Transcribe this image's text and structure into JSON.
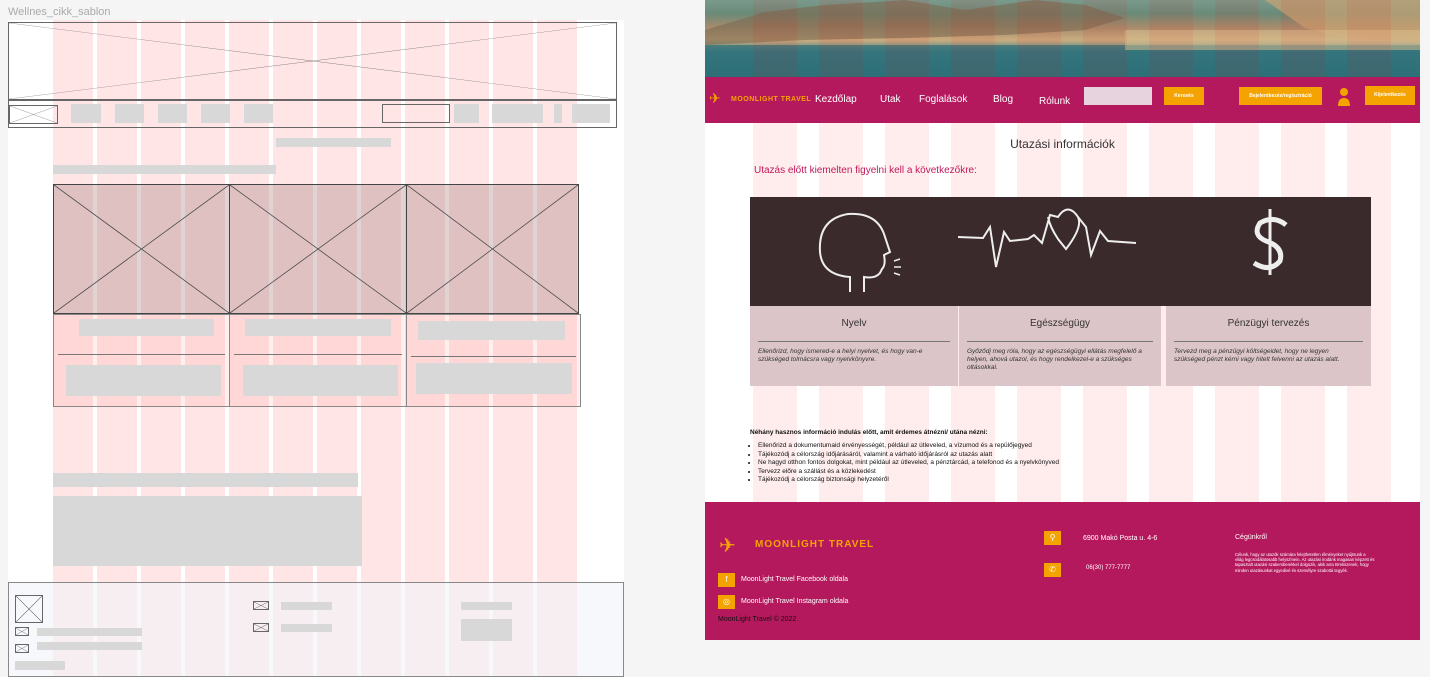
{
  "wireframe": {
    "frame_label": "Wellnes_cikk_sablon"
  },
  "site": {
    "brand": "MOONLIGHT TRAVEL",
    "nav": [
      "Kezdőlap",
      "Utak",
      "Foglalások",
      "Blog",
      "Rólunk"
    ],
    "search_placeholder": "",
    "search_button": "Keresés",
    "login_button": "Bejelentkezés/regisztráció",
    "logout_button": "Kijelentkezés",
    "colors": {
      "primary": "#b5195d",
      "accent": "#f5a300",
      "heading_accent": "#c2185b"
    }
  },
  "content": {
    "page_title": "Utazási információk",
    "subtitle": "Utazás előtt kiemelten figyelni kell a következőkre:",
    "cards": [
      {
        "icon": "head-speaking-icon",
        "title": "Nyelv",
        "text": "Ellenőrizd, hogy ismered-e a helyi nyelvet, és hogy van-e szükséged tolmácsra vagy nyelvkönyvre."
      },
      {
        "icon": "heartbeat-icon",
        "title": "Egészségügy",
        "text": "Győződj meg róla, hogy az egészségügyi ellátás megfelelő a helyen, ahová utazol, és hogy rendelkezel-e a szükséges oltásokkal."
      },
      {
        "icon": "dollar-icon",
        "title": "Pénzügyi tervezés",
        "text": "Tervezd meg a pénzügyi költségeidet, hogy ne legyen szükséged pénzt kérni vagy hitelt felvenni az utazás alatt."
      }
    ],
    "tips_title": "Néhány hasznos információ indulás előtt, amit érdemes átnézni/ utána nézni:",
    "tips": [
      "Ellenőrizd a dokumentumaid érvényességét, például az útleveled, a vízumod és a repülőjegyed",
      "Tájékozódj a célország időjárásáról, valamint a várható időjárásról az utazás alatt",
      "Ne hagyd otthon fontos dolgokat, mint például az útleveled, a pénztárcád, a telefonod és a nyelvkönyved",
      "Tervezz előre a szállást és a közlekedést",
      "Tájékozódj a célország biztonsági helyzetéről"
    ]
  },
  "footer": {
    "facebook": "MoonLight Travel Facebook oldala",
    "instagram": "MoonLight Travel Instagram oldala",
    "copyright": "MoonLight Travel © 2022",
    "address": "6900 Makó Posta u. 4-6",
    "phone": "06(30) 777-7777",
    "about_title": "Cégünkről",
    "about_text": "Célunk, hogy az utazók számára felejthetetlen élményeket nyújtsunk a világ legcsodálatosabb helyszínein. Az utazási irodánk magasan képzett és tapasztalt utazási szakemberekkel dolgozik, akik arra törekszenek, hogy minden utazásunkat egyedivé és személyre szabottá tegyék."
  }
}
